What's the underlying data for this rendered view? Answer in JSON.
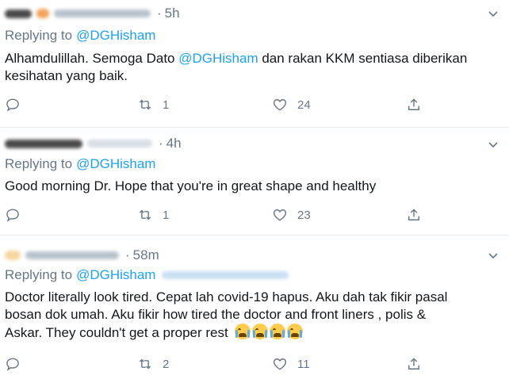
{
  "tweets": [
    {
      "time": "5h",
      "reply_prefix": "Replying to",
      "reply_to": "@DGHisham",
      "body_parts": [
        "Alhamdulillah. Semoga Dato ",
        "@DGHisham",
        " dan rakan KKM sentiasa diberikan"
      ],
      "body_line2": "kesihatan yang baik.",
      "retweets": "1",
      "likes": "24"
    },
    {
      "time": "4h",
      "reply_prefix": "Replying to",
      "reply_to": "@DGHisham",
      "body_line1": "Good morning Dr. Hope that you're in great shape and healthy",
      "retweets": "1",
      "likes": "23"
    },
    {
      "time": "58m",
      "reply_prefix": "Replying to",
      "reply_to": "@DGHisham",
      "body_line1": "Doctor literally look tired. Cepat lah covid-19 hapus. Aku dah tak fikir pasal",
      "body_line2": "bosan dok umah. Aku fikir how tired the doctor and front liners , polis &",
      "body_line3": "Askar. They couldn't get a proper rest",
      "retweets": "2",
      "likes": "11"
    }
  ],
  "icons": {
    "reply": "reply-icon",
    "retweet": "retweet-icon",
    "like": "heart-icon",
    "share": "share-icon",
    "menu": "chevron-down-icon",
    "emoji": "loudly-crying-face-icon"
  },
  "colors": {
    "text": "#14171a",
    "muted": "#657786",
    "link": "#1da1f2",
    "divider": "#e6ecf0"
  }
}
